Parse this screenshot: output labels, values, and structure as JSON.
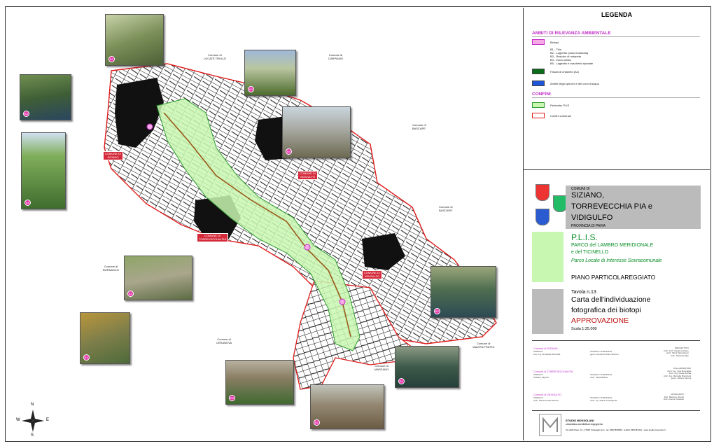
{
  "legend": {
    "title": "LEGENDA",
    "section_ambiti": "AMBITI DI RILEVANZA AMBIENTALE",
    "biotopi_label": "Biotopi",
    "biotopi_list": "B1 - Tiris\nB2 - Laghetto (cava rinaturata)\nB3 - Residuo di ontaneta\nB4 - Zona umida\nB5 - Laghetto e boschetto ripariale",
    "fascia_label": "Fascia di ontaneto (A1)",
    "ambiti_specchi_label": "Ambiti degli specchi e dei corsi d'acqua",
    "section_confini": "CONFINI",
    "perimetro_label": "Perimetro PLIS",
    "confini_comunali_label": "Confini comunali",
    "colors": {
      "biotopi": "#f7a8e6",
      "fascia": "#0a6b1a",
      "acqua": "#1d56d8",
      "plis": "#c8f7b2",
      "confini": "#e11b1b",
      "accent": "#c02cc8",
      "red_title": "#c01010",
      "green_text": "#0b8f2a"
    }
  },
  "title_block": {
    "comuni_di": "COMUNI DI",
    "comuni_line1": "SIZIANO,",
    "comuni_line2": "TORREVECCHIA PIA e",
    "comuni_line3": "VIDIGULFO",
    "provincia": "PROVINCIA DI PAVIA",
    "plis": "P.L.I.S.",
    "parco_line1": "PARCO del LAMBRO MERIDIONALE",
    "parco_line2": "e del TICINELLO",
    "parco_sub": "Parco Locale di Interesse Sovracomunale",
    "piano": "PIANO PARTICOLAREGGIATO",
    "tavola": "Tavola n.13",
    "carta_line1": "Carta dell'individuazione",
    "carta_line2": "fotografica dei biotopi",
    "approvazione": "APPROVAZIONE",
    "scala": "Scala 1:25.000"
  },
  "credits": {
    "row1_left": "Comune di SIZIANO",
    "row1_left_sub": "SINDACO\nAvv. Ing. Donatella Brambilla",
    "row1_mid": "TECNICO COMUNALE\ngeom. Giovanni Bruno Bonzini",
    "row1_right": "PROGETTISTI\nArch. Arch. Paola Amitrano\nArch. Silvia Maria Rossi\nArch. Stefania Rigo",
    "row2_left": "Comune di TORREVECCHIA PIA",
    "row2_left_sub": "SINDACO\nGiuliano Pigorini",
    "row2_mid": "TECNICO COMUNALE\nArch. Paola Belloni",
    "row2_right": "COLLABORATORI\nArch. Ing. Josè Buscaglia\nArch. Ing. Giulia Rovida\nArch. Ing. Marcella Bracchetti\ngeom. Alberto Zenoni",
    "row3_left": "Comune di VIDIGULFO",
    "row3_left_sub": "SINDACO\nArch. Paola Armida Ziaretti",
    "row3_mid": "TECNICO COMUNALE\nArch. Ing. Danilo Castagnola",
    "row3_right": "CONSULENTI\nDott. Massimo Faraci\nDott. Antonio Casadei",
    "studio_name": "STUDIO MOSSOLANI",
    "studio_sub": "urbanistica architettura ingegneria",
    "studio_address": "Via della Pace, 31 - 27040 Casteggio (pv) - tel. 0383-890896 - telefax 0383-84431 - www.studiomossolani.it"
  },
  "map": {
    "municipalities": [
      {
        "id": "lucernate",
        "text": "Comune di\nLOCATE TRIULZI"
      },
      {
        "id": "carpiano",
        "text": "Comune di\nCARPIANO"
      },
      {
        "id": "bascape1",
        "text": "Comune di\nBASCAPE'"
      },
      {
        "id": "bascape2",
        "text": "Comune di\nBASCAPE'"
      },
      {
        "id": "bornasco",
        "text": "Comune di\nBORNASCO"
      },
      {
        "id": "ceranova",
        "text": "Comune di\nCERANOVA"
      },
      {
        "id": "valera",
        "text": "Comune di\nVALERA FRATTA"
      },
      {
        "id": "marzano",
        "text": "Comune di\nMARZANO"
      }
    ],
    "callouts": [
      {
        "id": "siziano",
        "text": "COMUNE DI\nSIZIANO"
      },
      {
        "id": "vidigulfo",
        "text": "COMUNE DI\nVIDIGULFO"
      },
      {
        "id": "torrevecchia",
        "text": "COMUNE DI\nTORREVECCHIA PIA"
      },
      {
        "id": "vidigulfo2",
        "text": "COMUNE DI\nVIDIGULFO"
      }
    ],
    "photos": [
      "B1",
      "B2",
      "B3",
      "B4",
      "B5",
      "B1",
      "B2",
      "B3",
      "B4",
      "B5",
      "B1",
      "B2"
    ],
    "compass": {
      "n": "N",
      "s": "S",
      "e": "E",
      "w": "W"
    }
  }
}
